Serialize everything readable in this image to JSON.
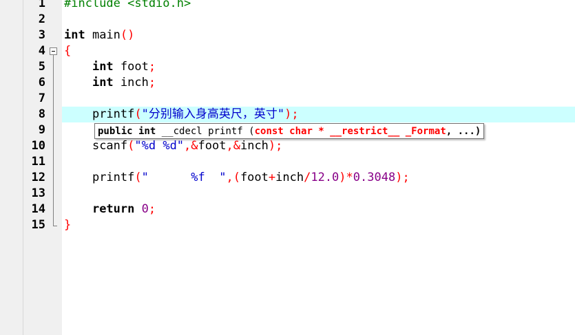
{
  "editor": {
    "line_numbers": [
      "1",
      "2",
      "3",
      "4",
      "5",
      "6",
      "7",
      "8",
      "9",
      "10",
      "11",
      "12",
      "13",
      "14",
      "15"
    ],
    "lines": {
      "l1_a": "#include <stdio.h>",
      "l3_kw": "int",
      "l3_b": " main",
      "l3_p": "()",
      "l4_p": "{",
      "l5_kw": "int",
      "l5_b": " foot",
      "l5_p": ";",
      "l6_kw": "int",
      "l6_b": " inch",
      "l6_p": ";",
      "l8_a": "printf",
      "l8_p1": "(",
      "l8_s": "\"分别输入身高英尺，英寸\"",
      "l8_p2": ");",
      "l10_a": "scanf",
      "l10_p1": "(",
      "l10_s": "\"%d %d\"",
      "l10_p2": ",&",
      "l10_b": "foot",
      "l10_p3": ",&",
      "l10_c": "inch",
      "l10_p4": ");",
      "l12_a": "printf",
      "l12_p1": "(",
      "l12_s": "\"      %f  \"",
      "l12_p2": ",(",
      "l12_b": "foot",
      "l12_p3": "+",
      "l12_c": "inch",
      "l12_p4": "/",
      "l12_n1": "12.0",
      "l12_p5": ")*",
      "l12_n2": "0.3048",
      "l12_p6": ");",
      "l14_kw": "return",
      "l14_sp": " ",
      "l14_n": "0",
      "l14_p": ";",
      "l15_p": "}"
    }
  },
  "tooltip": {
    "kw1": "public int",
    "plain1": " __cdecl printf (",
    "kw2": "const char * __restrict__ _Format",
    "plain2": ", ...)"
  },
  "colors": {
    "keyword": "#000000",
    "preprocessor": "#008000",
    "string": "#0000cc",
    "operator": "#ff0000",
    "number": "#880088",
    "current_line": "#ccffff",
    "gutter": "#f0f0f0"
  }
}
